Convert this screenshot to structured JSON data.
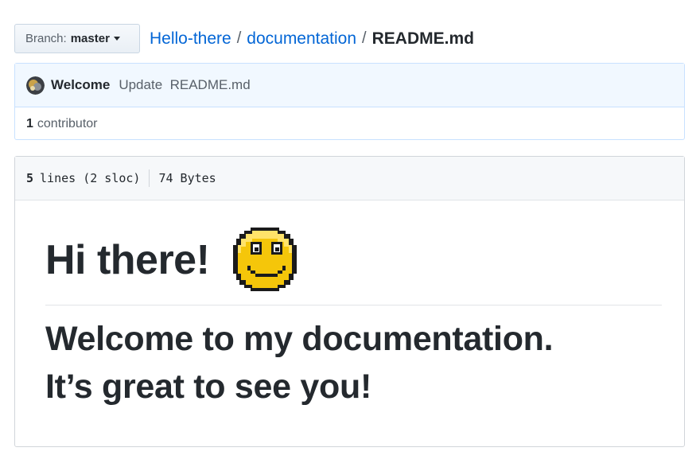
{
  "branch": {
    "label": "Branch:",
    "name": "master"
  },
  "breadcrumb": {
    "repo": "Hello-there",
    "folder": "documentation",
    "separator": "/",
    "file": "README.md"
  },
  "commit": {
    "author": "Welcome",
    "message": "Update  README.md"
  },
  "contributors": {
    "count": "1",
    "label": "contributor"
  },
  "file_info": {
    "lines": "5",
    "lines_rest": "lines (2 sloc)",
    "size": "74 Bytes"
  },
  "readme": {
    "heading": "Hi there!",
    "line1": "Welcome to my documentation.",
    "line2": "It’s great to see you!"
  },
  "colors": {
    "link": "#0366d6",
    "text": "#24292e",
    "muted": "#586069",
    "commit_bg": "#f1f8ff",
    "smiley": "#f5c60a"
  },
  "icons": {
    "avatar": "avatar-image",
    "emoji": "smiley-face-emoji",
    "caret": "caret-down-icon"
  }
}
